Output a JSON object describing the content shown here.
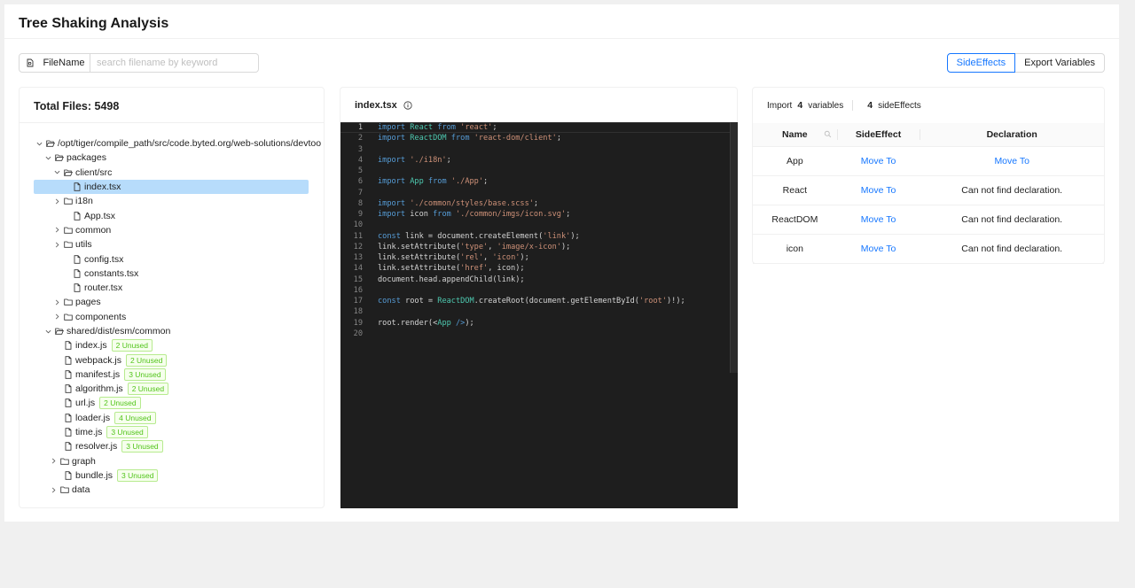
{
  "header": {
    "title": "Tree Shaking Analysis"
  },
  "filter": {
    "label": "FileName",
    "placeholder": "search filename by keyword"
  },
  "segments": {
    "active": "SideEffects",
    "other": "Export Variables"
  },
  "tree": {
    "title": "Total Files: 5498",
    "nodes": [
      {
        "label": "/opt/tiger/compile_path/src/code.byted.org/web-solutions/devtoo",
        "depth": 0,
        "type": "folder-open",
        "caret": "down"
      },
      {
        "label": "packages",
        "depth": 1,
        "type": "folder-open",
        "caret": "down"
      },
      {
        "label": "client/src",
        "depth": 2,
        "type": "folder-open",
        "caret": "down"
      },
      {
        "label": "index.tsx",
        "depth": 3,
        "type": "file",
        "caret": "",
        "selected": true
      },
      {
        "label": "i18n",
        "depth": 2,
        "type": "folder",
        "caret": "right"
      },
      {
        "label": "App.tsx",
        "depth": 3,
        "type": "file",
        "caret": ""
      },
      {
        "label": "common",
        "depth": 2,
        "type": "folder",
        "caret": "right"
      },
      {
        "label": "utils",
        "depth": 2,
        "type": "folder",
        "caret": "right"
      },
      {
        "label": "config.tsx",
        "depth": 3,
        "type": "file",
        "caret": ""
      },
      {
        "label": "constants.tsx",
        "depth": 3,
        "type": "file",
        "caret": ""
      },
      {
        "label": "router.tsx",
        "depth": 3,
        "type": "file",
        "caret": ""
      },
      {
        "label": "pages",
        "depth": 2,
        "type": "folder",
        "caret": "right"
      },
      {
        "label": "components",
        "depth": 2,
        "type": "folder",
        "caret": "right"
      },
      {
        "label": "shared/dist/esm/common",
        "depth": 1,
        "type": "folder-open",
        "caret": "down"
      },
      {
        "label": "index.js",
        "depth": 2,
        "type": "file",
        "caret": "",
        "badge": "2 Unused"
      },
      {
        "label": "webpack.js",
        "depth": 2,
        "type": "file",
        "caret": "",
        "badge": "2 Unused"
      },
      {
        "label": "manifest.js",
        "depth": 2,
        "type": "file",
        "caret": "",
        "badge": "3 Unused"
      },
      {
        "label": "algorithm.js",
        "depth": 2,
        "type": "file",
        "caret": "",
        "badge": "2 Unused"
      },
      {
        "label": "url.js",
        "depth": 2,
        "type": "file",
        "caret": "",
        "badge": "2 Unused"
      },
      {
        "label": "loader.js",
        "depth": 2,
        "type": "file",
        "caret": "",
        "badge": "4 Unused"
      },
      {
        "label": "time.js",
        "depth": 2,
        "type": "file",
        "caret": "",
        "badge": "3 Unused"
      },
      {
        "label": "resolver.js",
        "depth": 2,
        "type": "file",
        "caret": "",
        "badge": "3 Unused"
      },
      {
        "label": "graph",
        "depth": 1.6,
        "type": "folder",
        "caret": "right"
      },
      {
        "label": "bundle.js",
        "depth": 2,
        "type": "file",
        "caret": "",
        "badge": "3 Unused"
      },
      {
        "label": "data",
        "depth": 1.6,
        "type": "folder",
        "caret": "right"
      }
    ]
  },
  "editor": {
    "filename": "index.tsx",
    "current_line": 1,
    "lines": [
      [
        [
          "kw",
          "import "
        ],
        [
          "ty",
          "React"
        ],
        [
          "kw",
          " from "
        ],
        [
          "str",
          "'react'"
        ],
        [
          "",
          "; "
        ]
      ],
      [
        [
          "kw",
          "import "
        ],
        [
          "ty",
          "ReactDOM"
        ],
        [
          "kw",
          " from "
        ],
        [
          "str",
          "'react-dom/client'"
        ],
        [
          "",
          ";"
        ]
      ],
      [],
      [
        [
          "kw",
          "import "
        ],
        [
          "str",
          "'./i18n'"
        ],
        [
          "",
          ";"
        ]
      ],
      [],
      [
        [
          "kw",
          "import "
        ],
        [
          "ty",
          "App"
        ],
        [
          "kw",
          " from "
        ],
        [
          "str",
          "'./App'"
        ],
        [
          "",
          ";"
        ]
      ],
      [],
      [
        [
          "kw",
          "import "
        ],
        [
          "str",
          "'./common/styles/base.scss'"
        ],
        [
          "",
          ";"
        ]
      ],
      [
        [
          "kw",
          "import "
        ],
        [
          "",
          "icon"
        ],
        [
          "kw",
          " from "
        ],
        [
          "str",
          "'./common/imgs/icon.svg'"
        ],
        [
          "",
          ";"
        ]
      ],
      [],
      [
        [
          "kw",
          "const "
        ],
        [
          "",
          "link = document.createElement("
        ],
        [
          "str",
          "'link'"
        ],
        [
          "",
          ");"
        ]
      ],
      [
        [
          "",
          "link.setAttribute("
        ],
        [
          "str",
          "'type'"
        ],
        [
          "",
          ", "
        ],
        [
          "str",
          "'image/x-icon'"
        ],
        [
          "",
          ");"
        ]
      ],
      [
        [
          "",
          "link.setAttribute("
        ],
        [
          "str",
          "'rel'"
        ],
        [
          "",
          ", "
        ],
        [
          "str",
          "'icon'"
        ],
        [
          "",
          ");"
        ]
      ],
      [
        [
          "",
          "link.setAttribute("
        ],
        [
          "str",
          "'href'"
        ],
        [
          "",
          ", icon);"
        ]
      ],
      [
        [
          "",
          "document.head.appendChild(link);"
        ]
      ],
      [],
      [
        [
          "kw",
          "const "
        ],
        [
          "",
          "root = "
        ],
        [
          "ty",
          "ReactDOM"
        ],
        [
          "",
          ".createRoot(document.getElementById("
        ],
        [
          "str",
          "'root'"
        ],
        [
          "",
          ")!);"
        ]
      ],
      [],
      [
        [
          "",
          "root.render(<"
        ],
        [
          "ty",
          "App"
        ],
        [
          "kw",
          " />"
        ],
        [
          "",
          ");"
        ]
      ],
      []
    ]
  },
  "side": {
    "import_label": "Import",
    "import_count": "4",
    "variables_label": "variables",
    "side_count": "4",
    "side_label": "sideEffects",
    "columns": [
      "Name",
      "SideEffect",
      "Declaration"
    ],
    "rows": [
      {
        "name": "App",
        "side": "Move To",
        "decl": "Move To",
        "decl_link": true
      },
      {
        "name": "React",
        "side": "Move To",
        "decl": "Can not find declaration.",
        "decl_link": false
      },
      {
        "name": "ReactDOM",
        "side": "Move To",
        "decl": "Can not find declaration.",
        "decl_link": false
      },
      {
        "name": "icon",
        "side": "Move To",
        "decl": "Can not find declaration.",
        "decl_link": false
      }
    ]
  }
}
